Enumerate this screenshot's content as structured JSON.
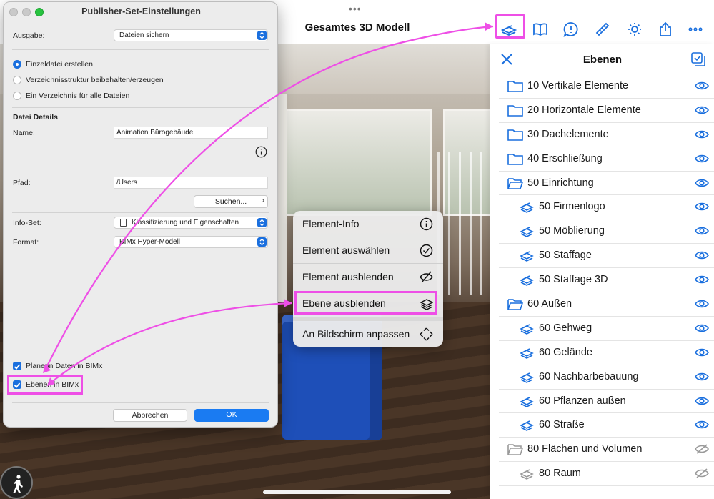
{
  "ipad": {
    "title": "Gesamtes 3D Modell",
    "dots": "•••",
    "toolbar": [
      "layers-icon",
      "book-icon",
      "info-bubble-icon",
      "ruler-icon",
      "sun-icon",
      "share-icon",
      "more-icon"
    ]
  },
  "layers": {
    "title": "Ebenen",
    "items": [
      {
        "label": "10 Vertikale Elemente",
        "kind": "folder",
        "visible": true
      },
      {
        "label": "20 Horizontale Elemente",
        "kind": "folder",
        "visible": true
      },
      {
        "label": "30 Dachelemente",
        "kind": "folder",
        "visible": true
      },
      {
        "label": "40 Erschließung",
        "kind": "folder",
        "visible": true
      },
      {
        "label": "50 Einrichtung",
        "kind": "folder-open",
        "visible": true
      },
      {
        "label": "50 Firmenlogo",
        "kind": "layer",
        "visible": true
      },
      {
        "label": "50 Möblierung",
        "kind": "layer",
        "visible": true
      },
      {
        "label": "50 Staffage",
        "kind": "layer",
        "visible": true
      },
      {
        "label": "50 Staffage 3D",
        "kind": "layer",
        "visible": true
      },
      {
        "label": "60 Außen",
        "kind": "folder-open",
        "visible": true
      },
      {
        "label": "60 Gehweg",
        "kind": "layer",
        "visible": true
      },
      {
        "label": "60 Gelände",
        "kind": "layer",
        "visible": true
      },
      {
        "label": "60 Nachbarbebauung",
        "kind": "layer",
        "visible": true
      },
      {
        "label": "60 Pflanzen außen",
        "kind": "layer",
        "visible": true
      },
      {
        "label": "60 Straße",
        "kind": "layer",
        "visible": true
      },
      {
        "label": "80 Flächen und Volumen",
        "kind": "folder-open",
        "visible": false
      },
      {
        "label": "80 Raum",
        "kind": "layer",
        "visible": false
      }
    ]
  },
  "context_menu": {
    "items": [
      {
        "label": "Element-Info",
        "icon": "info-icon"
      },
      {
        "label": "Element auswählen",
        "icon": "check-circle-icon"
      },
      {
        "label": "Element ausblenden",
        "icon": "eye-slash-icon"
      },
      {
        "label": "Ebene ausblenden",
        "icon": "layers-icon"
      },
      {
        "label": "An Bildschirm anpassen",
        "icon": "fit-screen-icon"
      }
    ]
  },
  "dialog": {
    "title": "Publisher-Set-Einstellungen",
    "ausgabe_label": "Ausgabe:",
    "ausgabe_value": "Dateien sichern",
    "radios": [
      {
        "label": "Einzeldatei erstellen",
        "checked": true
      },
      {
        "label": "Verzeichnisstruktur beibehalten/erzeugen",
        "checked": false
      },
      {
        "label": "Ein Verzeichnis für alle Dateien",
        "checked": false
      }
    ],
    "details_heading": "Datei Details",
    "name_label": "Name:",
    "name_value": "Animation Bürogebäude",
    "pfad_label": "Pfad:",
    "pfad_value": "/Users",
    "suchen_label": "Suchen...",
    "infoset_label": "Info-Set:",
    "infoset_value": "Klassifizierung und Eigenschaften",
    "format_label": "Format:",
    "format_value": "BIMx Hyper-Modell",
    "cb_planer_label": "Planerin Daten in BIMx",
    "cb_ebenen_label": "Ebenen in BIMx",
    "cancel_label": "Abbrechen",
    "ok_label": "OK"
  },
  "colors": {
    "accent": "#1a6fde",
    "highlight": "#ee4fe6",
    "sofa": "#1e4fb8"
  }
}
